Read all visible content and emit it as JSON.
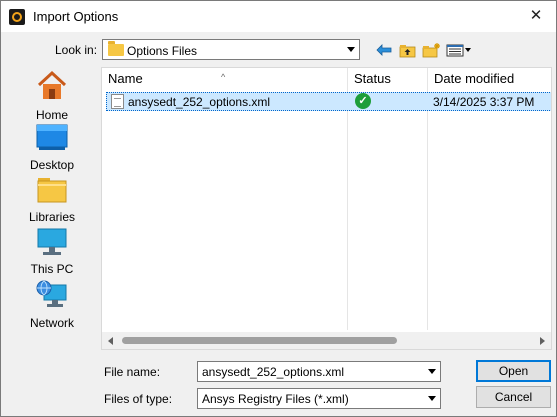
{
  "window": {
    "title": "Import Options",
    "close_glyph": "✕"
  },
  "lookin": {
    "label": "Look in:",
    "value": "Options Files",
    "toolbar_icons": [
      "back-arrow-icon",
      "up-folder-icon",
      "new-folder-icon",
      "view-menu-icon"
    ]
  },
  "places": [
    {
      "label": "Home",
      "icon": "home-icon"
    },
    {
      "label": "Desktop",
      "icon": "desktop-icon"
    },
    {
      "label": "Libraries",
      "icon": "libraries-icon"
    },
    {
      "label": "This PC",
      "icon": "this-pc-icon"
    },
    {
      "label": "Network",
      "icon": "network-icon"
    }
  ],
  "columns": {
    "name": "Name",
    "status": "Status",
    "date": "Date modified"
  },
  "files": [
    {
      "name": "ansysedt_252_options.xml",
      "status_icon": "check-circle-icon",
      "date": "3/14/2025 3:37 PM"
    }
  ],
  "filename": {
    "label": "File name:",
    "value": "ansysedt_252_options.xml"
  },
  "filetype": {
    "label": "Files of type:",
    "value": "Ansys Registry Files (*.xml)"
  },
  "buttons": {
    "open": "Open",
    "cancel": "Cancel"
  },
  "colors": {
    "selection": "#cce8ff",
    "accent": "#0078d7",
    "status_ok": "#1e9e3a"
  }
}
